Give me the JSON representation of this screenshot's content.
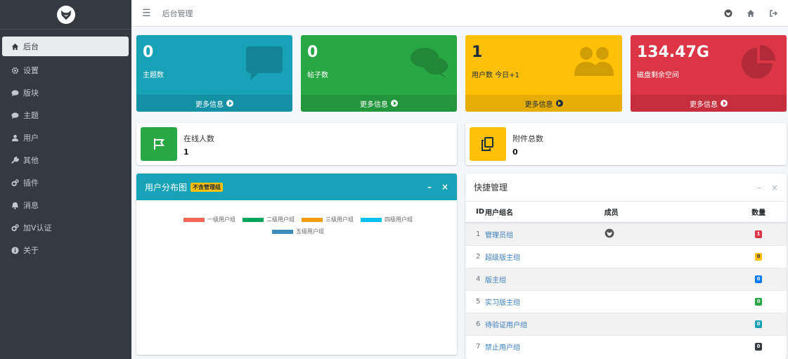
{
  "sidebar": {
    "items": [
      {
        "label": "后台",
        "icon": "home-icon"
      },
      {
        "label": "设置",
        "icon": "gear-icon"
      },
      {
        "label": "版块",
        "icon": "comment-icon"
      },
      {
        "label": "主题",
        "icon": "comment-icon"
      },
      {
        "label": "用户",
        "icon": "user-icon"
      },
      {
        "label": "其他",
        "icon": "wrench-icon"
      },
      {
        "label": "插件",
        "icon": "cogs-icon"
      },
      {
        "label": "消息",
        "icon": "bell-icon"
      },
      {
        "label": "加V认证",
        "icon": "cogs-icon"
      },
      {
        "label": "关于",
        "icon": "info-icon"
      }
    ]
  },
  "header": {
    "title": "后台管理"
  },
  "stats": [
    {
      "value": "0",
      "label": "主题数",
      "footer": "更多信息",
      "color": "#17a2b8",
      "icon": "comment-icon"
    },
    {
      "value": "0",
      "label": "帖子数",
      "footer": "更多信息",
      "color": "#28a745",
      "icon": "comments-icon"
    },
    {
      "value": "1",
      "label": "用户数 今日+1",
      "footer": "更多信息",
      "color": "#ffc107",
      "icon": "users-icon"
    },
    {
      "value": "134.47G",
      "label": "磁盘剩余空间",
      "footer": "更多信息",
      "color": "#dc3545",
      "icon": "pie-chart-icon"
    }
  ],
  "info": [
    {
      "title": "在线人数",
      "value": "1",
      "color": "#28a745",
      "icon": "flag-icon"
    },
    {
      "title": "附件总数",
      "value": "0",
      "color": "#ffc107",
      "icon": "copy-icon"
    }
  ],
  "user_dist": {
    "title": "用户分布图",
    "badge": "不含管理组",
    "legend": [
      {
        "name": "一级用户组",
        "color": "#f56954"
      },
      {
        "name": "二级用户组",
        "color": "#00a65a"
      },
      {
        "name": "三级用户组",
        "color": "#f39c12"
      },
      {
        "name": "四级用户组",
        "color": "#00c0ef"
      },
      {
        "name": "五级用户组",
        "color": "#3c8dbc"
      }
    ]
  },
  "quick": {
    "title": "快捷管理",
    "columns": [
      "ID",
      "用户组名",
      "成员",
      "数量"
    ],
    "rows": [
      {
        "id": "1",
        "name": "管理员组",
        "member": true,
        "count": "1",
        "color": "#dc3545"
      },
      {
        "id": "2",
        "name": "超级版主组",
        "member": false,
        "count": "0",
        "color": "#ffc107"
      },
      {
        "id": "4",
        "name": "版主组",
        "member": false,
        "count": "0",
        "color": "#007bff"
      },
      {
        "id": "5",
        "name": "实习版主组",
        "member": false,
        "count": "0",
        "color": "#28a745"
      },
      {
        "id": "6",
        "name": "待验证用户组",
        "member": false,
        "count": "0",
        "color": "#17a2b8"
      },
      {
        "id": "7",
        "name": "禁止用户组",
        "member": false,
        "count": "0",
        "color": "#343a40"
      }
    ]
  }
}
